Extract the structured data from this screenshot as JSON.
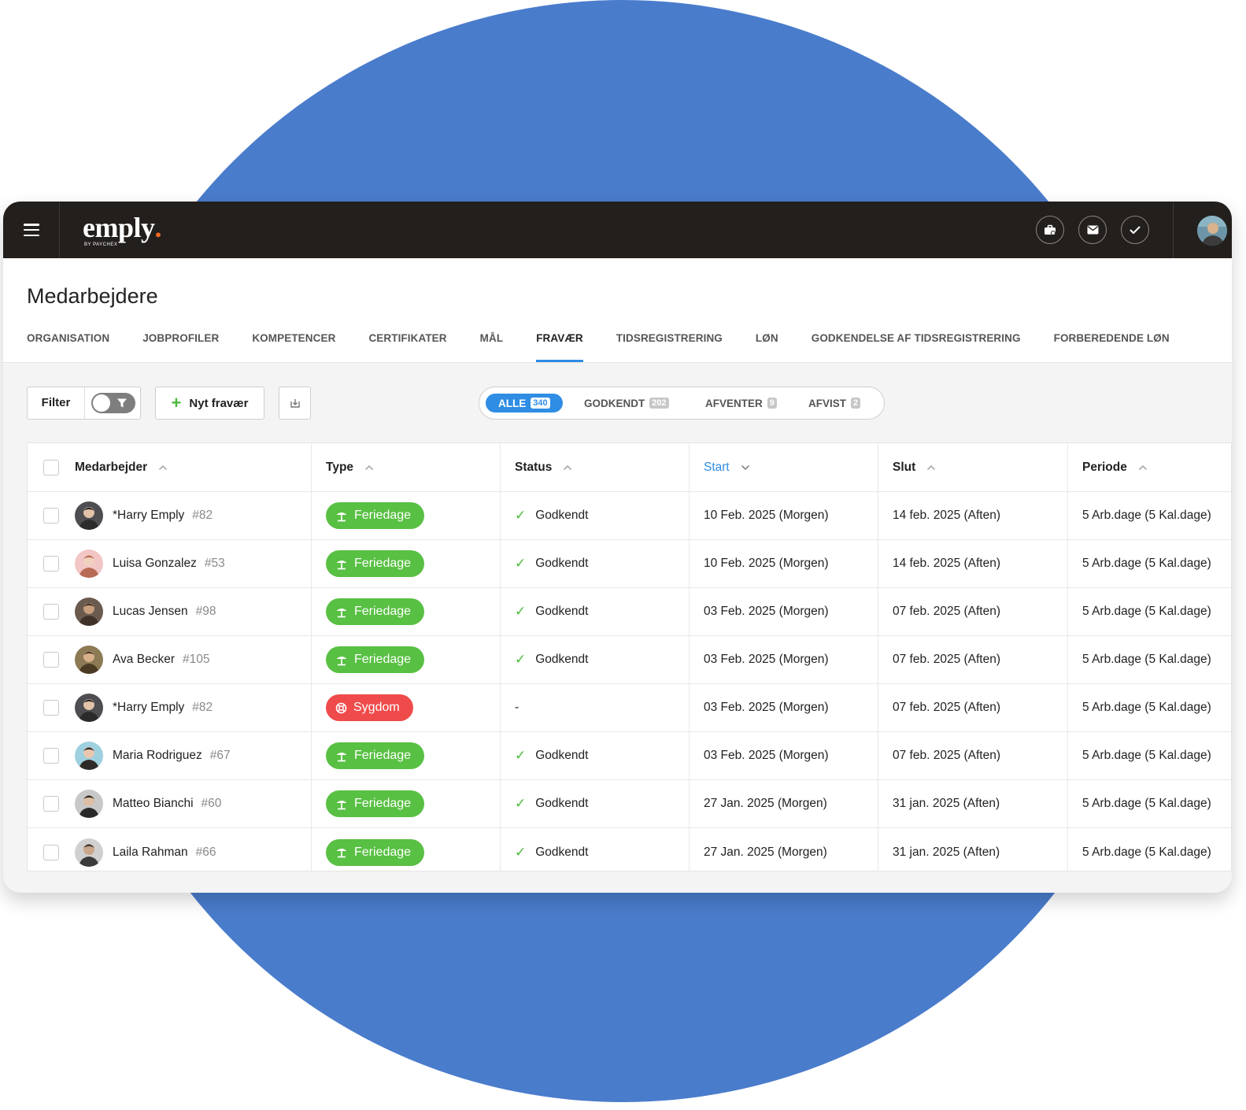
{
  "app": {
    "logo_text": "emply",
    "logo_sub": "BY PAYCHEX",
    "accent": "#2f8de4",
    "topbar_color": "#231f1d"
  },
  "page": {
    "title": "Medarbejdere"
  },
  "tabs": [
    {
      "label": "ORGANISATION"
    },
    {
      "label": "JOBPROFILER"
    },
    {
      "label": "KOMPETENCER"
    },
    {
      "label": "CERTIFIKATER"
    },
    {
      "label": "MÅL"
    },
    {
      "label": "FRAVÆR",
      "active": true
    },
    {
      "label": "TIDSREGISTRERING"
    },
    {
      "label": "LØN"
    },
    {
      "label": "GODKENDELSE AF TIDSREGISTRERING"
    },
    {
      "label": "FORBEREDENDE LØN"
    }
  ],
  "toolbar": {
    "filter_label": "Filter",
    "new_label": "Nyt fravær"
  },
  "status_filter": [
    {
      "label": "ALLE",
      "count": "340",
      "active": true
    },
    {
      "label": "GODKENDT",
      "count": "202"
    },
    {
      "label": "AFVENTER",
      "count": "9"
    },
    {
      "label": "AFVIST",
      "count": "2"
    }
  ],
  "table": {
    "columns": [
      "Medarbejder",
      "Type",
      "Status",
      "Start",
      "Slut",
      "Periode"
    ],
    "sorted_column": "Start",
    "rows": [
      {
        "name": "*Harry Emply",
        "id": "#82",
        "type": "Feriedage",
        "status": "Godkendt",
        "start": "10 Feb. 2025 (Morgen)",
        "end": "14 feb. 2025 (Aften)",
        "period": "5 Arb.dage (5 Kal.dage)"
      },
      {
        "name": "Luisa Gonzalez",
        "id": "#53",
        "type": "Feriedage",
        "status": "Godkendt",
        "start": "10 Feb. 2025 (Morgen)",
        "end": "14 feb. 2025 (Aften)",
        "period": "5 Arb.dage (5 Kal.dage)"
      },
      {
        "name": "Lucas Jensen",
        "id": "#98",
        "type": "Feriedage",
        "status": "Godkendt",
        "start": "03 Feb. 2025 (Morgen)",
        "end": "07 feb. 2025 (Aften)",
        "period": "5 Arb.dage (5 Kal.dage)"
      },
      {
        "name": "Ava Becker",
        "id": "#105",
        "type": "Feriedage",
        "status": "Godkendt",
        "start": "03 Feb. 2025 (Morgen)",
        "end": "07 feb. 2025 (Aften)",
        "period": "5 Arb.dage (5 Kal.dage)"
      },
      {
        "name": "*Harry Emply",
        "id": "#82",
        "type": "Sygdom",
        "status": "-",
        "start": "03 Feb. 2025 (Morgen)",
        "end": "07 feb. 2025 (Aften)",
        "period": "5 Arb.dage (5 Kal.dage)"
      },
      {
        "name": "Maria Rodriguez",
        "id": "#67",
        "type": "Feriedage",
        "status": "Godkendt",
        "start": "03 Feb. 2025 (Morgen)",
        "end": "07 feb. 2025 (Aften)",
        "period": "5 Arb.dage (5 Kal.dage)"
      },
      {
        "name": "Matteo Bianchi",
        "id": "#60",
        "type": "Feriedage",
        "status": "Godkendt",
        "start": "27 Jan. 2025 (Morgen)",
        "end": "31 jan. 2025 (Aften)",
        "period": "5 Arb.dage (5 Kal.dage)"
      },
      {
        "name": "Laila Rahman",
        "id": "#66",
        "type": "Feriedage",
        "status": "Godkendt",
        "start": "27 Jan. 2025 (Morgen)",
        "end": "31 jan. 2025 (Aften)",
        "period": "5 Arb.dage (5 Kal.dage)"
      }
    ]
  },
  "icons": {
    "menu": "hamburger-icon",
    "top": [
      "briefcase-icon",
      "mail-icon",
      "check-icon"
    ],
    "vacation": "beach-umbrella-icon",
    "sick": "lifebuoy-icon",
    "export": "export-icon"
  }
}
